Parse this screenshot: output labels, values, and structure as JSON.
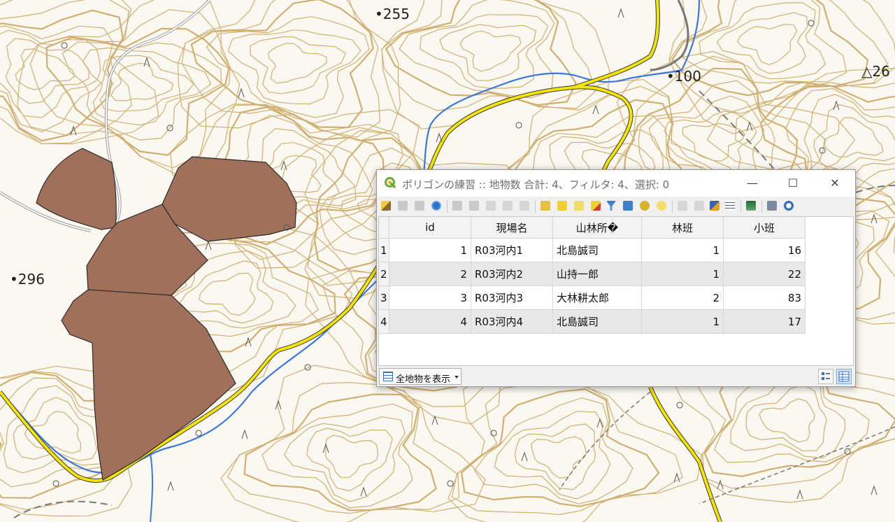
{
  "map": {
    "spot_heights": [
      {
        "name": "spot-height-255",
        "label": "255"
      },
      {
        "name": "spot-height-100",
        "label": "100"
      },
      {
        "name": "spot-height-296",
        "label": "296"
      },
      {
        "name": "triangulation-point-26",
        "label": "26"
      }
    ],
    "polygon_fill": "#a0705a",
    "contour_color": "#c8a060",
    "road_color": "#f5e400",
    "river_color": "#3a7ee0"
  },
  "window": {
    "title": "ポリゴンの練習 :: 地物数 合計: 4、フィルタ: 4、選択: 0",
    "minimize_label": "—",
    "maximize_label": "☐",
    "close_label": "✕"
  },
  "table": {
    "columns": [
      "id",
      "現場名",
      "山林所�",
      "林班",
      "小班"
    ],
    "rows": [
      {
        "row_number": "1",
        "id": "1",
        "site": "R03河内1",
        "owner": "北島誠司",
        "forest_block": "1",
        "sub_block": "16"
      },
      {
        "row_number": "2",
        "id": "2",
        "site": "R03河内2",
        "owner": "山持一郎",
        "forest_block": "1",
        "sub_block": "22"
      },
      {
        "row_number": "3",
        "id": "3",
        "site": "R03河内3",
        "owner": "大林耕太郎",
        "forest_block": "2",
        "sub_block": "83"
      },
      {
        "row_number": "4",
        "id": "4",
        "site": "R03河内4",
        "owner": "北島誠司",
        "forest_block": "1",
        "sub_block": "17"
      }
    ]
  },
  "bottom": {
    "filter_label": "全地物を表示"
  },
  "icons": {
    "app": "qgis-icon",
    "toolbar": [
      "edit-pencil-icon",
      "multi-edit-icon",
      "save-icon",
      "reload-icon",
      "add-feature-icon",
      "delete-feature-icon",
      "cut-icon",
      "copy-icon",
      "paste-icon",
      "select-expression-icon",
      "select-all-icon",
      "invert-selection-icon",
      "deselect-icon",
      "filter-icon",
      "move-top-icon",
      "pan-icon",
      "zoom-icon",
      "copy-cells-icon",
      "paste-cells-icon",
      "delete-field-icon",
      "new-field-icon",
      "field-calculator-icon",
      "conditional-format-icon",
      "actions-icon",
      "dock-icon"
    ]
  }
}
